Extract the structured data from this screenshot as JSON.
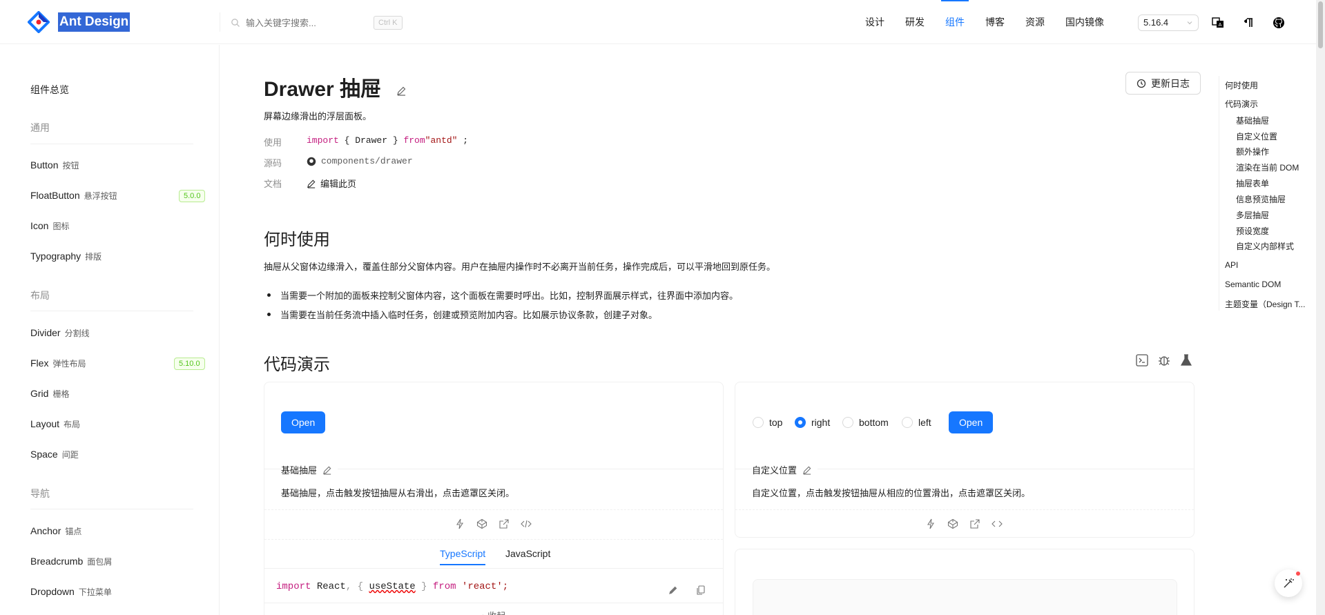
{
  "header": {
    "logo_text": "Ant Design",
    "search_placeholder": "输入关键字搜索...",
    "search_shortcut": "Ctrl K",
    "nav": [
      "设计",
      "研发",
      "组件",
      "博客",
      "资源",
      "国内镜像"
    ],
    "nav_active_index": 2,
    "version": "5.16.4"
  },
  "sidebar": {
    "overview": "组件总览",
    "groups": [
      {
        "title": "通用",
        "items": [
          {
            "en": "Button",
            "cn": "按钮"
          },
          {
            "en": "FloatButton",
            "cn": "悬浮按钮",
            "badge": "5.0.0"
          },
          {
            "en": "Icon",
            "cn": "图标"
          },
          {
            "en": "Typography",
            "cn": "排版"
          }
        ]
      },
      {
        "title": "布局",
        "items": [
          {
            "en": "Divider",
            "cn": "分割线"
          },
          {
            "en": "Flex",
            "cn": "弹性布局",
            "badge": "5.10.0"
          },
          {
            "en": "Grid",
            "cn": "栅格"
          },
          {
            "en": "Layout",
            "cn": "布局"
          },
          {
            "en": "Space",
            "cn": "间距"
          }
        ]
      },
      {
        "title": "导航",
        "items": [
          {
            "en": "Anchor",
            "cn": "锚点"
          },
          {
            "en": "Breadcrumb",
            "cn": "面包屑"
          },
          {
            "en": "Dropdown",
            "cn": "下拉菜单"
          }
        ]
      }
    ]
  },
  "main": {
    "title": "Drawer 抽屉",
    "changelog": "更新日志",
    "subtitle": "屏幕边缘滑出的浮层面板。",
    "meta": {
      "use_label": "使用",
      "import_kw": "import",
      "import_body": "{ Drawer }",
      "from_kw": "from",
      "import_src": "\"antd\"",
      "semicolon": ";",
      "source_label": "源码",
      "source_path": "components/drawer",
      "doc_label": "文档",
      "doc_link": "编辑此页"
    },
    "when_title": "何时使用",
    "when_para": "抽屉从父窗体边缘滑入，覆盖住部分父窗体内容。用户在抽屉内操作时不必离开当前任务，操作完成后，可以平滑地回到原任务。",
    "bullets": [
      "当需要一个附加的面板来控制父窗体内容，这个面板在需要时呼出。比如，控制界面展示样式，往界面中添加内容。",
      "当需要在当前任务流中插入临时任务，创建或预览附加内容。比如展示协议条款，创建子对象。"
    ],
    "demo_title": "代码演示",
    "demos": {
      "basic": {
        "button": "Open",
        "title": "基础抽屉",
        "desc": "基础抽屉，点击触发按钮抽屉从右滑出，点击遮罩区关闭。",
        "tabs": [
          "TypeScript",
          "JavaScript"
        ],
        "code": {
          "kw1": "import",
          "name": "React",
          "sep": ", {",
          "hook": "useState",
          "close": "}",
          "kw2": "from",
          "src": "'react';"
        },
        "collapse": "收起"
      },
      "placement": {
        "options": [
          "top",
          "right",
          "bottom",
          "left"
        ],
        "selected": "right",
        "button": "Open",
        "title": "自定义位置",
        "desc": "自定义位置，点击触发按钮抽屉从相应的位置滑出，点击遮罩区关闭。"
      }
    }
  },
  "toc": {
    "items": [
      {
        "label": "何时使用",
        "level": 1
      },
      {
        "label": "代码演示",
        "level": 1
      },
      {
        "label": "基础抽屉",
        "level": 2
      },
      {
        "label": "自定义位置",
        "level": 2
      },
      {
        "label": "额外操作",
        "level": 2
      },
      {
        "label": "渲染在当前 DOM",
        "level": 2
      },
      {
        "label": "抽屉表单",
        "level": 2
      },
      {
        "label": "信息预览抽屉",
        "level": 2
      },
      {
        "label": "多层抽屉",
        "level": 2
      },
      {
        "label": "预设宽度",
        "level": 2
      },
      {
        "label": "自定义内部样式",
        "level": 2
      },
      {
        "label": "API",
        "level": 1
      },
      {
        "label": "Semantic DOM",
        "level": 1
      },
      {
        "label": "主题变量（Design T...",
        "level": 1
      }
    ]
  },
  "colors": {
    "primary": "#1677ff",
    "success": "#52c41a",
    "keyword": "#c41d7f",
    "string": "#a31515"
  }
}
